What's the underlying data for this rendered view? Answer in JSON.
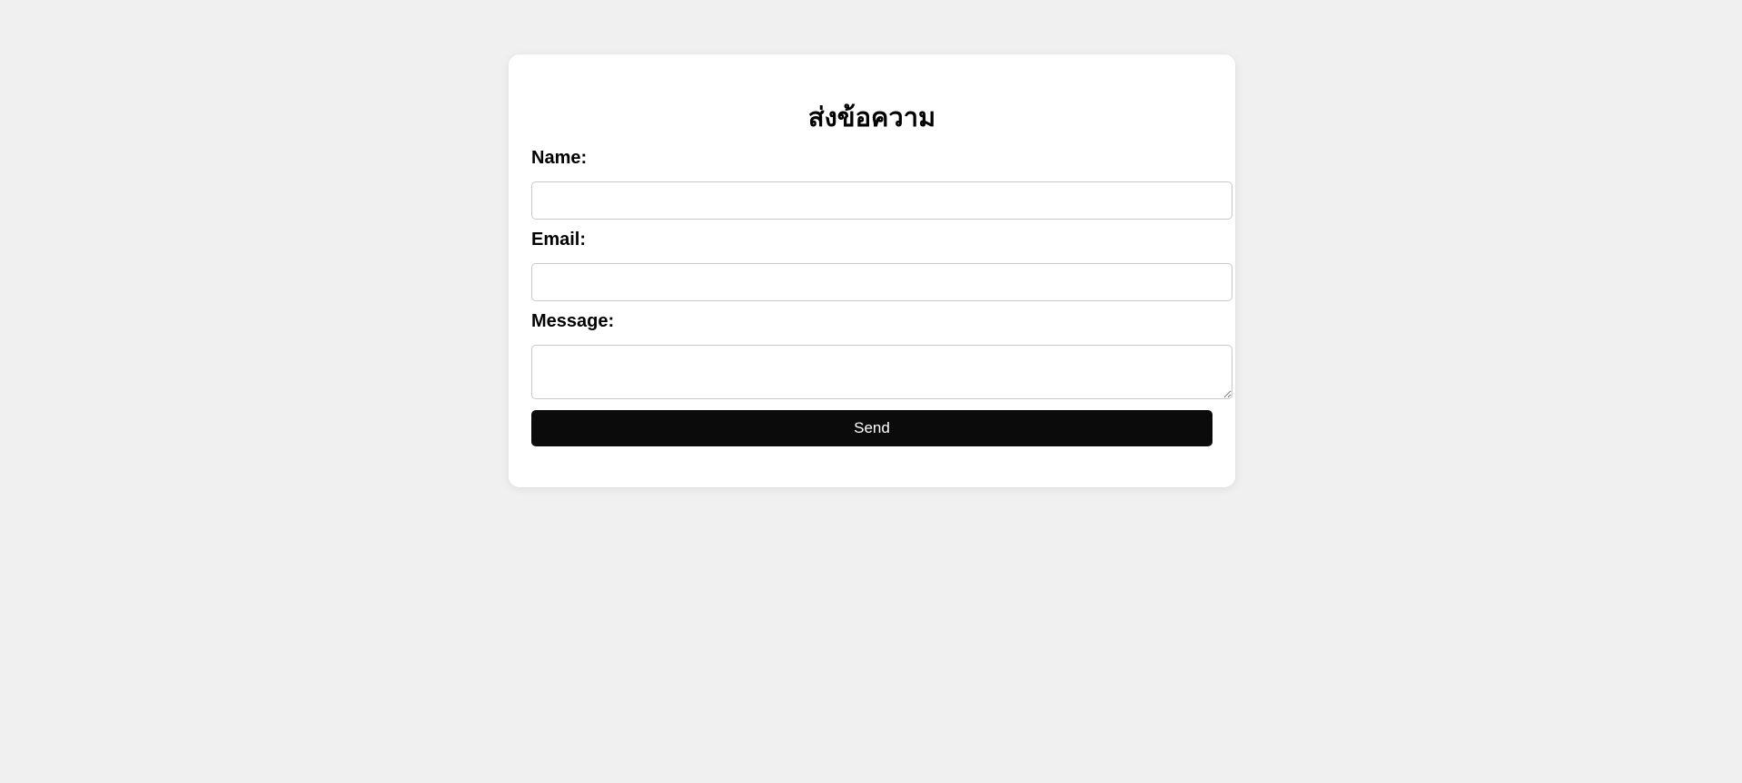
{
  "form": {
    "title": "ส่งข้อความ",
    "fields": [
      {
        "label": "Name:",
        "value": "",
        "placeholder": ""
      },
      {
        "label": "Email:",
        "value": "",
        "placeholder": ""
      },
      {
        "label": "Message:",
        "value": "",
        "placeholder": ""
      }
    ],
    "submit_label": "Send"
  },
  "colors": {
    "page_background": "#f0f0f0",
    "card_background": "#ffffff",
    "button_background": "#0b0b0b",
    "button_text": "#ffffff",
    "input_border": "#c9c9c9"
  }
}
